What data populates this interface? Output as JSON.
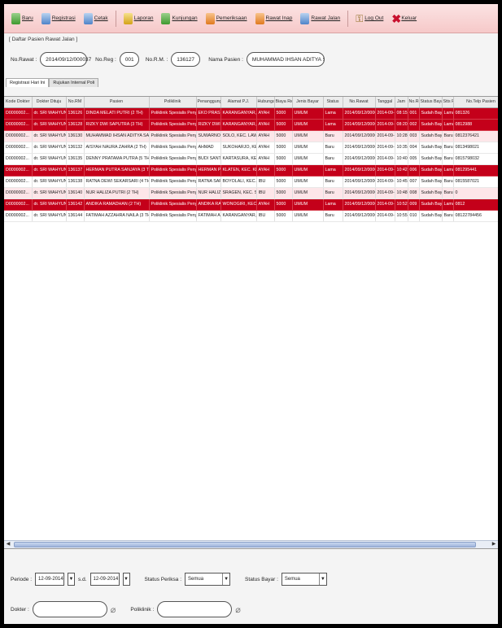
{
  "toolbar": {
    "items": [
      {
        "label": "Baru",
        "icon": "new-icon"
      },
      {
        "label": "Registrasi",
        "icon": "register-icon"
      },
      {
        "label": "Cetak",
        "icon": "print-icon"
      },
      {
        "label": "Laporan",
        "icon": "report-icon"
      },
      {
        "label": "Kunjungan",
        "icon": "visit-icon"
      },
      {
        "label": "Pemeriksaan",
        "icon": "exam-icon"
      },
      {
        "label": "Rawat Inap",
        "icon": "inpatient-icon"
      },
      {
        "label": "Rawat Jalan",
        "icon": "outpatient-icon"
      },
      {
        "label": "Log Out",
        "icon": "logout-icon"
      },
      {
        "label": "Keluar",
        "icon": "exit-icon"
      }
    ]
  },
  "subtitle": "[ Daftar Pasien Rawat Jalan ]",
  "filters": {
    "no_rawat_label": "No.Rawat :",
    "no_rawat_value": "2014/09/12/000037",
    "no_reg_label": "No.Reg :",
    "no_reg_value": "001",
    "no_rm_label": "No.R.M. :",
    "no_rm_value": "136127",
    "nama_pasien_label": "Nama Pasien :",
    "nama_pasien_value": "MUHAMMAD IHSAN ADITYA SANDI (2 TH)"
  },
  "tabs": [
    "Registrasi Hari Ini",
    "Rujukan Internal Poli"
  ],
  "table": {
    "columns": [
      "Kode Dokter",
      "Dokter Dituju",
      "No.RM",
      "Pasien",
      "Poliklinik",
      "Penanggung Jawab",
      "Alamat P.J.",
      "Hubungan P.J.",
      "Biaya Reg",
      "Jenis Bayar",
      "Status",
      "No.Rawat",
      "Tanggal",
      "Jam",
      "No.Reg",
      "Status Bayar",
      "Stts Poli",
      "No.Telp Pasien"
    ],
    "rows": [
      {
        "style": "red",
        "cells": [
          "D0000002...",
          "dr. SRI WAHYUNI, M.Kes",
          "136126",
          "DINDA MELATI PUTRI (2 TH)",
          "Poliklinik Spesialis Penyakit Dalam",
          "EKO PRASETYO",
          "KARANGANYAR, KEC. JATEN...",
          "AYAH",
          "5000",
          "UMUM",
          "Lama",
          "2014/09/12/000001",
          "2014-09-12",
          "08:15:02",
          "001",
          "Sudah Bayar",
          "Lama",
          "081326"
        ]
      },
      {
        "style": "red",
        "cells": [
          "D0000002...",
          "dr. SRI WAHYUNI, M.Kes",
          "136128",
          "RIZKY DWI SAPUTRA (3 TH)",
          "Poliklinik Spesialis Penyakit Dalam",
          "RIZKY DWI SAPUTRA",
          "KARANGANYAR, KEC. JATEN...",
          "AYAH",
          "5000",
          "UMUM",
          "Lama",
          "2014/09/12/000004",
          "2014-09-12",
          "08:20:47",
          "002",
          "Sudah Bayar",
          "Lama",
          "0812988"
        ]
      },
      {
        "style": "pink",
        "cells": [
          "D0000002...",
          "dr. SRI WAHYUNI, M.Kes",
          "136130",
          "MUHAMMAD IHSAN ADITYA SANDI (2 TH)",
          "Poliklinik Spesialis Penyakit Dalam",
          "SUWARNO",
          "SOLO, KEC. LAWEYAN...",
          "AYAH",
          "5000",
          "UMUM",
          "Baru",
          "2014/09/12/000037",
          "2014-09-12",
          "10:28:12",
          "003",
          "Sudah Bayar",
          "Baru",
          "0812376421"
        ]
      },
      {
        "style": "white",
        "cells": [
          "D0000002...",
          "dr. SRI WAHYUNI, M.Kes",
          "136132",
          "AISYAH NAURA ZAHRA (2 TH)",
          "Poliklinik Spesialis Penyakit Dalam",
          "AHMAD",
          "SUKOHARJO, KEC. GROGOL...",
          "AYAH",
          "5000",
          "UMUM",
          "Baru",
          "2014/09/12/000040",
          "2014-09-12",
          "10:35:14",
          "004",
          "Sudah Bayar",
          "Baru",
          "0813498021"
        ]
      },
      {
        "style": "white",
        "cells": [
          "D0000002...",
          "dr. SRI WAHYUNI, M.Kes",
          "136135",
          "DENNY PRATAMA PUTRA (5 TH)",
          "Poliklinik Spesialis Penyakit Dalam",
          "BUDI SANTOSO",
          "KARTASURA, KEC. KARTASURA...",
          "AYAH",
          "5000",
          "UMUM",
          "Baru",
          "2014/09/12/000042",
          "2014-09-12",
          "10:40:47",
          "005",
          "Sudah Bayar",
          "Baru",
          "0815798032"
        ]
      },
      {
        "style": "red",
        "cells": [
          "D0000002...",
          "dr. SRI WAHYUNI, M.Kes",
          "136137",
          "HERMAN PUTRA SANJAYA (3 TH)",
          "Poliklinik Spesialis Penyakit Dalam",
          "HERMAN PUTRA SANJAYA",
          "KLATEN, KEC. KLATEN UTARA...",
          "AYAH",
          "5000",
          "UMUM",
          "Lama",
          "2014/09/12/000045",
          "2014-09-12",
          "10:42:47",
          "006",
          "Sudah Bayar",
          "Lama",
          "081295441"
        ]
      },
      {
        "style": "white",
        "cells": [
          "D0000002...",
          "dr. SRI WAHYUNI, M.Kes",
          "136138",
          "RATNA DEWI SEKARSARI (4 TH)",
          "Poliklinik Spesialis Penyakit Dalam",
          "RATNA SARI",
          "BOYOLALI, KEC. BOYOLALI...",
          "IBU",
          "5000",
          "UMUM",
          "Baru",
          "2014/09/12/000049",
          "2014-09-12",
          "10:45:17",
          "007",
          "Sudah Bayar",
          "Baru",
          "0815587021"
        ]
      },
      {
        "style": "pink",
        "cells": [
          "D0000002...",
          "dr. SRI WAHYUNI, M.Kes",
          "136140",
          "NUR HALIZA PUTRI (2 TH)",
          "Poliklinik Spesialis Penyakit Dalam",
          "NUR HALIZA PUTRI",
          "SRAGEN, KEC. SRAGEN KOTA...",
          "IBU",
          "5000",
          "UMUM",
          "Baru",
          "2014/09/12/000052",
          "2014-09-12",
          "10:48:35",
          "008",
          "Sudah Bayar",
          "Baru",
          "0"
        ]
      },
      {
        "style": "red",
        "cells": [
          "D0000002...",
          "dr. SRI WAHYUNI, M.Kes",
          "136142",
          "ANDIKA RAMADHAN (2 TH)",
          "Poliklinik Spesialis Penyakit Dalam",
          "ANDIKA RAMADHAN",
          "WONOGIRI, KEC. WONOGIRI...",
          "AYAH",
          "5000",
          "UMUM",
          "Lama",
          "2014/09/12/000055",
          "2014-09-12",
          "10:52:26",
          "009",
          "Sudah Bayar",
          "Lama",
          "0812"
        ]
      },
      {
        "style": "white",
        "cells": [
          "D0000002...",
          "dr. SRI WAHYUNI, M.Kes",
          "136144",
          "FATIMAH AZZAHRA NAILA (3 TH)",
          "Poliklinik Spesialis Penyakit Dalam",
          "FATIMAH AZZAHRA NAILA",
          "KARANGANYAR, KEC. KARANGPANDAN...",
          "IBU",
          "5000",
          "UMUM",
          "Baru",
          "2014/09/12/000058",
          "2014-09-12",
          "10:55:53",
          "010",
          "Sudah Bayar",
          "Baru",
          "08122784456"
        ]
      }
    ]
  },
  "bottom": {
    "periode_label": "Periode :",
    "date_from": "12-09-2014",
    "sd_label": "s.d.",
    "date_to": "12-09-2014",
    "status_periksa_label": "Status Periksa :",
    "status_periksa_value": "Semua",
    "status_bayar_label": "Status Bayar :",
    "status_bayar_value": "Semua",
    "dokter_label": "Dokter :",
    "poliklinik_label": "Poliklinik :"
  }
}
